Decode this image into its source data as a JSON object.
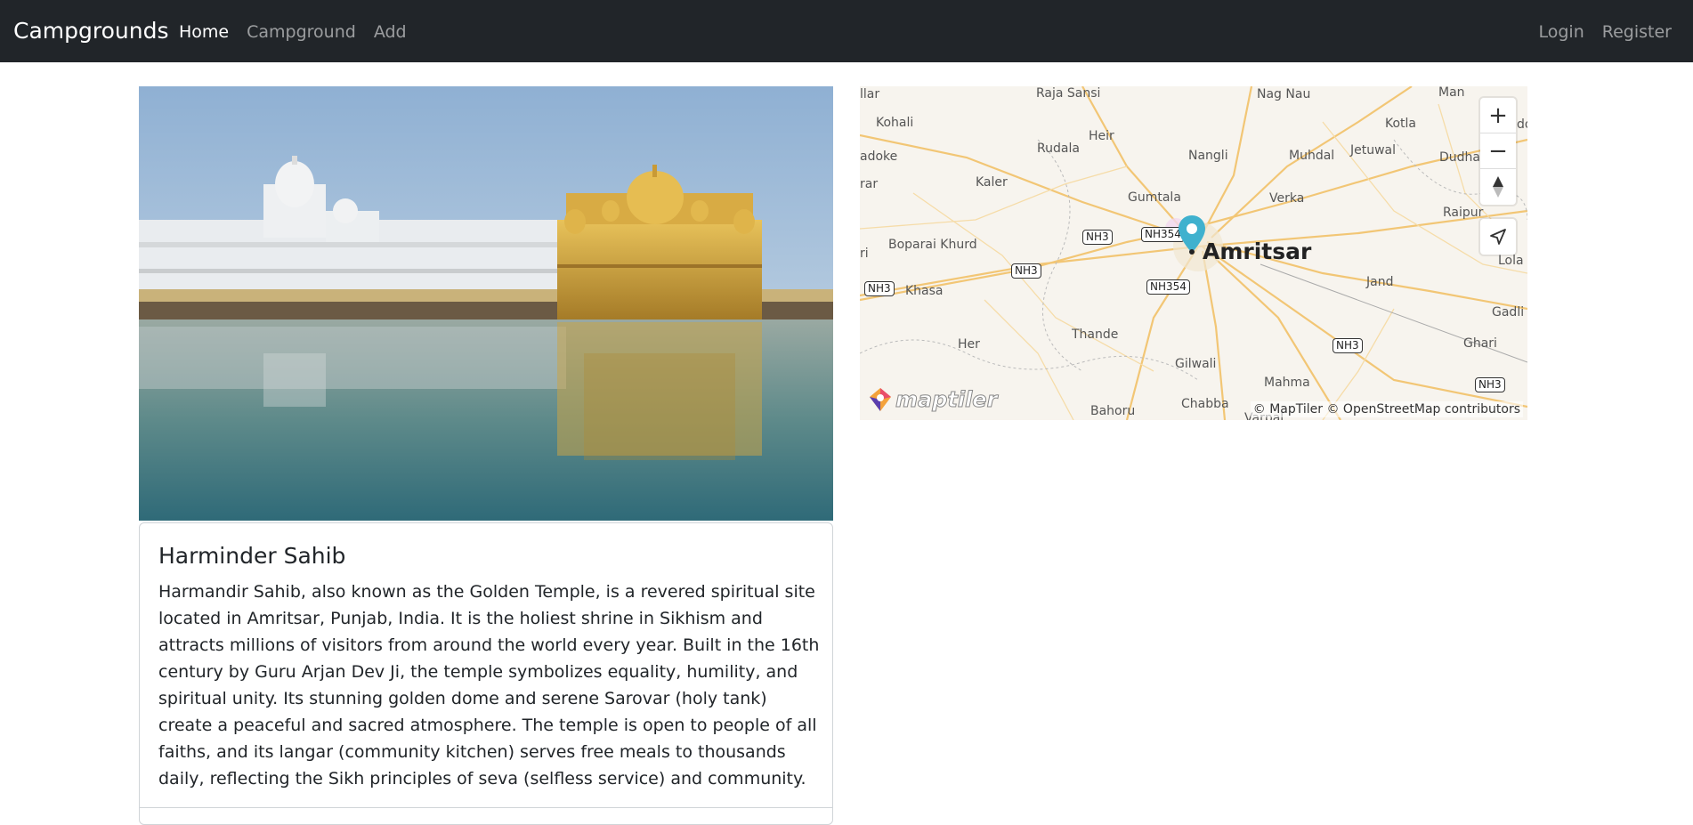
{
  "navbar": {
    "brand": "Campgrounds",
    "links": [
      {
        "label": "Home",
        "active": true
      },
      {
        "label": "Campground",
        "active": false
      },
      {
        "label": "Add",
        "active": false
      }
    ],
    "right_links": [
      {
        "label": "Login"
      },
      {
        "label": "Register"
      }
    ]
  },
  "card": {
    "title": "Harminder Sahib",
    "description": "Harmandir Sahib, also known as the Golden Temple, is a revered spiritual site located in Amritsar, Punjab, India. It is the holiest shrine in Sikhism and attracts millions of visitors from around the world every year. Built in the 16th century by Guru Arjan Dev Ji, the temple symbolizes equality, humility, and spiritual unity. Its stunning golden dome and serene Sarovar (holy tank) create a peaceful and sacred atmosphere. The temple is open to people of all faiths, and its langar (community kitchen) serves free meals to thousands daily, reflecting the Sikh principles of seva (selfless service) and community."
  },
  "map": {
    "city": "Amritsar",
    "places": [
      "llar",
      "Raja Sansi",
      "Nag Nau",
      "Man",
      "Kohali",
      "Heir",
      "Kotla",
      "Rudala",
      "Nangli",
      "Muhdal",
      "Jetuwal",
      "Dudha",
      "adoke",
      "Kaler",
      "Gumtala",
      "Verka",
      "rar",
      "Raipur",
      "Boparai Khurd",
      "Lola",
      "Khasa",
      "Jand",
      "Gadli",
      "Thande",
      "Her",
      "Ghari",
      "Gilwali",
      "Mahma",
      "Bahoru",
      "Chabba",
      "Varpal",
      "ri",
      "do"
    ],
    "shields": [
      "NH3",
      "NH354",
      "NH3",
      "NH354",
      "NH3",
      "NH3",
      "NH3"
    ],
    "zoom_in": "+",
    "zoom_out": "−",
    "attribution": "© MapTiler © OpenStreetMap contributors",
    "logo_text": "maptiler"
  },
  "colors": {
    "navbar_bg": "#212529",
    "marker": "#3fb1ce"
  }
}
